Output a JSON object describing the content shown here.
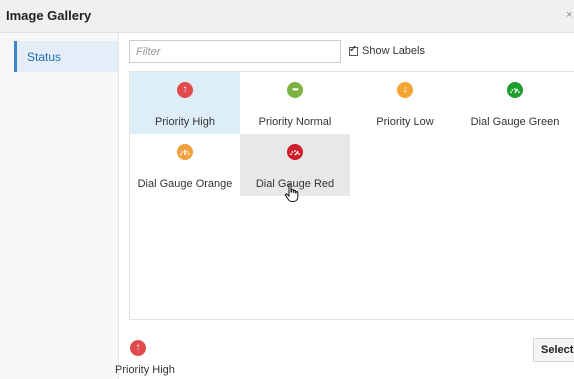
{
  "window": {
    "title": "Image Gallery",
    "close_glyph": "×"
  },
  "sidebar": {
    "items": [
      {
        "label": "Status",
        "selected": true
      }
    ]
  },
  "filter": {
    "placeholder": "Filter",
    "value": ""
  },
  "show_labels": {
    "label": "Show Labels",
    "checked": true
  },
  "gallery": {
    "items": [
      {
        "label": "Priority High",
        "icon": "arrow-up-circle-icon",
        "color": "#e04b4b",
        "selected": true
      },
      {
        "label": "Priority Normal",
        "icon": "ellipsis-circle-icon",
        "color": "#7cb342"
      },
      {
        "label": "Priority Low",
        "icon": "arrow-down-circle-icon",
        "color": "#f3a532"
      },
      {
        "label": "Dial Gauge Green",
        "icon": "dial-gauge-icon",
        "color": "#1e9e2f"
      },
      {
        "label": "Dial Gauge Orange",
        "icon": "dial-gauge-icon",
        "color": "#f0a03c"
      },
      {
        "label": "Dial Gauge Red",
        "icon": "dial-gauge-icon",
        "color": "#cc1f2b",
        "hovered": true
      }
    ]
  },
  "preview": {
    "label": "Priority High",
    "icon": "arrow-up-circle-icon",
    "color": "#e04b4b"
  },
  "footer": {
    "select_label": "Select"
  }
}
